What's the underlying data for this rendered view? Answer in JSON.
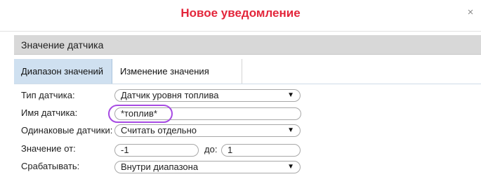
{
  "dialog": {
    "title": "Новое уведомление",
    "close_symbol": "×",
    "section_title": "Значение датчика"
  },
  "tabs": [
    {
      "label": "Диапазон значений",
      "active": true
    },
    {
      "label": "Изменение значения",
      "active": false
    }
  ],
  "form": {
    "sensor_type": {
      "label": "Тип датчика:",
      "value": "Датчик уровня топлива"
    },
    "sensor_name": {
      "label": "Имя датчика:",
      "value": "*топлив*"
    },
    "same_sensors": {
      "label": "Одинаковые датчики:",
      "value": "Считать отдельно"
    },
    "value_from": {
      "label": "Значение от:",
      "value": "-1"
    },
    "value_to": {
      "label": "до:",
      "value": "1"
    },
    "trigger": {
      "label": "Срабатывать:",
      "value": "Внутри диапазона"
    }
  },
  "colors": {
    "title": "#e3263b",
    "active_tab": "#cfe0f0",
    "section_header": "#d8d8d8",
    "highlight": "#a74be3"
  },
  "icons": {
    "close": "close-icon",
    "dropdown": "chevron-down-icon"
  }
}
